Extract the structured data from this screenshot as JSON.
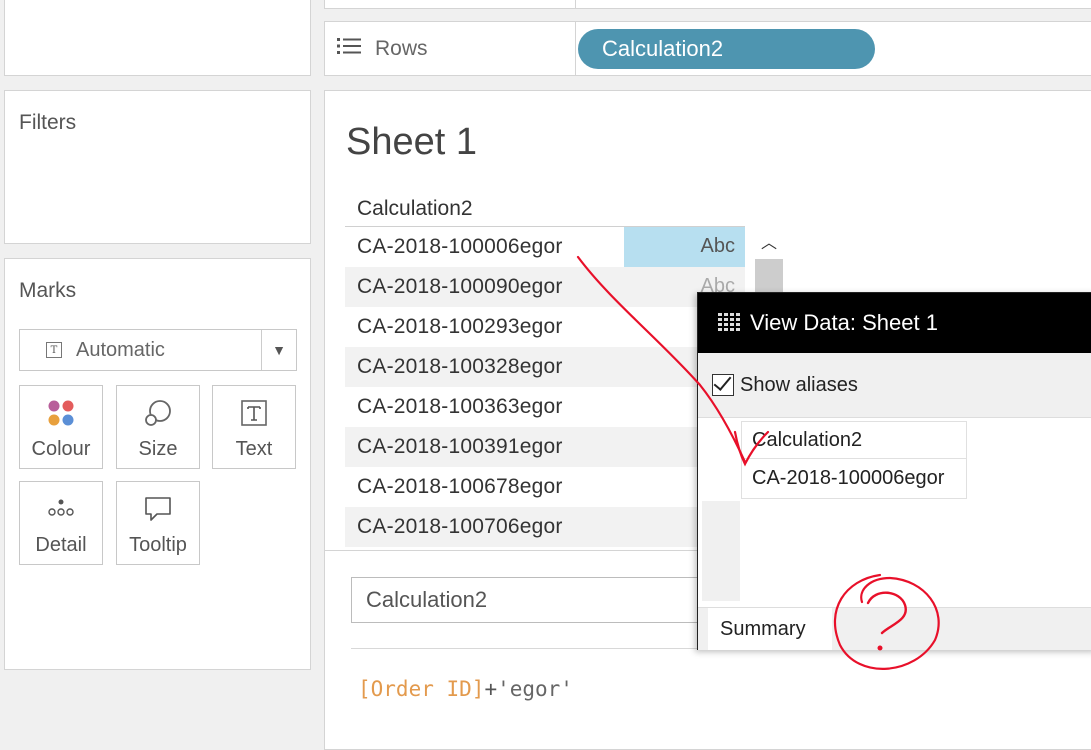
{
  "left_panels": {
    "filters_title": "Filters",
    "marks_title": "Marks",
    "mark_type": "Automatic",
    "mark_buttons": {
      "colour": "Colour",
      "size": "Size",
      "text": "Text",
      "detail": "Detail",
      "tooltip": "Tooltip"
    }
  },
  "shelf": {
    "rows_label": "Rows",
    "rows_pill": "Calculation2",
    "pill_color": "#4e95b0"
  },
  "sheet": {
    "title": "Sheet 1",
    "column_header": "Calculation2",
    "rows": [
      "CA-2018-100006egor",
      "CA-2018-100090egor",
      "CA-2018-100293egor",
      "CA-2018-100328egor",
      "CA-2018-100363egor",
      "CA-2018-100391egor",
      "CA-2018-100678egor",
      "CA-2018-100706egor"
    ],
    "abc_selected": "Abc",
    "abc_faded": "Abc",
    "selection_color": "#b7dff0"
  },
  "calc_editor": {
    "name": "Calculation2",
    "formula_field": "[Order ID]",
    "formula_op": "+",
    "formula_string": "'egor'"
  },
  "view_data": {
    "title": "View Data: Sheet 1",
    "show_aliases_label": "Show aliases",
    "show_aliases_checked": true,
    "column_header": "Calculation2",
    "cell_value": "CA-2018-100006egor",
    "tab_summary": "Summary"
  },
  "annotation": {
    "question_mark": "?",
    "color": "#e8102a"
  }
}
